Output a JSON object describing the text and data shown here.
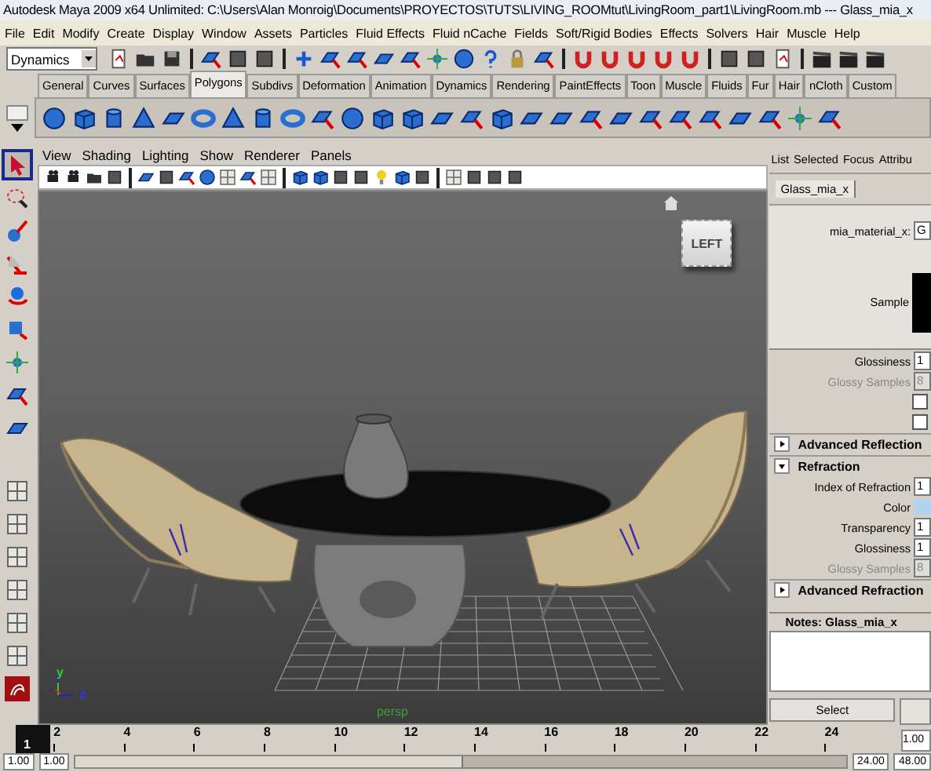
{
  "window": {
    "title": "Autodesk Maya 2009 x64 Unlimited: C:\\Users\\Alan Monroig\\Documents\\PROYECTOS\\TUTS\\LIVING_ROOMtut\\LivingRoom_part1\\LivingRoom.mb  ---  Glass_mia_x"
  },
  "menu_bar": [
    "File",
    "Edit",
    "Modify",
    "Create",
    "Display",
    "Window",
    "Assets",
    "Particles",
    "Fluid Effects",
    "Fluid nCache",
    "Fields",
    "Soft/Rigid Bodies",
    "Effects",
    "Solvers",
    "Hair",
    "Muscle",
    "Help"
  ],
  "status_line": {
    "menu_set": "Dynamics"
  },
  "shelf_tabs": [
    {
      "label": "General",
      "selected": false
    },
    {
      "label": "Curves",
      "selected": false
    },
    {
      "label": "Surfaces",
      "selected": false
    },
    {
      "label": "Polygons",
      "selected": true
    },
    {
      "label": "Subdivs",
      "selected": false
    },
    {
      "label": "Deformation",
      "selected": false
    },
    {
      "label": "Animation",
      "selected": false
    },
    {
      "label": "Dynamics",
      "selected": false
    },
    {
      "label": "Rendering",
      "selected": false
    },
    {
      "label": "PaintEffects",
      "selected": false
    },
    {
      "label": "Toon",
      "selected": false
    },
    {
      "label": "Muscle",
      "selected": false
    },
    {
      "label": "Fluids",
      "selected": false
    },
    {
      "label": "Fur",
      "selected": false
    },
    {
      "label": "Hair",
      "selected": false
    },
    {
      "label": "nCloth",
      "selected": false
    },
    {
      "label": "Custom",
      "selected": false
    }
  ],
  "toolbox": [
    {
      "selected": true
    },
    {
      "selected": false
    },
    {
      "selected": false
    },
    {
      "selected": false
    },
    {
      "selected": false
    },
    {
      "selected": false
    },
    {
      "selected": false
    },
    {
      "selected": false
    },
    {
      "selected": false
    }
  ],
  "viewport": {
    "menus": [
      "View",
      "Shading",
      "Lighting",
      "Show",
      "Renderer",
      "Panels"
    ],
    "view_cube": "LEFT",
    "camera": "persp",
    "axis_labels": [
      "y",
      "z"
    ]
  },
  "attribute_editor": {
    "menus": [
      "List",
      "Selected",
      "Focus",
      "Attribu"
    ],
    "tab": "Glass_mia_x",
    "material_label": "mia_material_x:",
    "material_value": "G",
    "sample_label": "Sample",
    "rows": [
      {
        "kind": "field",
        "label": "Glossiness",
        "value": "1",
        "disabled": false
      },
      {
        "kind": "field",
        "label": "Glossy Samples",
        "value": "8",
        "disabled": true
      },
      {
        "kind": "checkbox",
        "checked": false
      },
      {
        "kind": "checkbox",
        "checked": false
      },
      {
        "kind": "section",
        "label": "Advanced Reflection",
        "expanded": false
      },
      {
        "kind": "section",
        "label": "Refraction",
        "expanded": true
      },
      {
        "kind": "field",
        "label": "Index of Refraction",
        "value": "1",
        "disabled": false
      },
      {
        "kind": "color",
        "label": "Color",
        "color": "#b4d4ee"
      },
      {
        "kind": "field",
        "label": "Transparency",
        "value": "1",
        "disabled": false
      },
      {
        "kind": "field",
        "label": "Glossiness",
        "value": "1",
        "disabled": false
      },
      {
        "kind": "field",
        "label": "Glossy Samples",
        "value": "8",
        "disabled": true
      },
      {
        "kind": "section",
        "label": "Advanced Refraction",
        "expanded": false
      }
    ],
    "notes_label": "Notes:  Glass_mia_x",
    "buttons": [
      "Select"
    ]
  },
  "timeline": {
    "current_frame": "1",
    "labels": [
      "2",
      "4",
      "6",
      "8",
      "10",
      "12",
      "14",
      "16",
      "18",
      "20",
      "22",
      "24"
    ],
    "end_field": "1.00"
  },
  "range_slider": {
    "start": "1.00",
    "playback_start": "1.00",
    "playback_end": "24.00",
    "end": "48.00",
    "level": 0.5
  }
}
